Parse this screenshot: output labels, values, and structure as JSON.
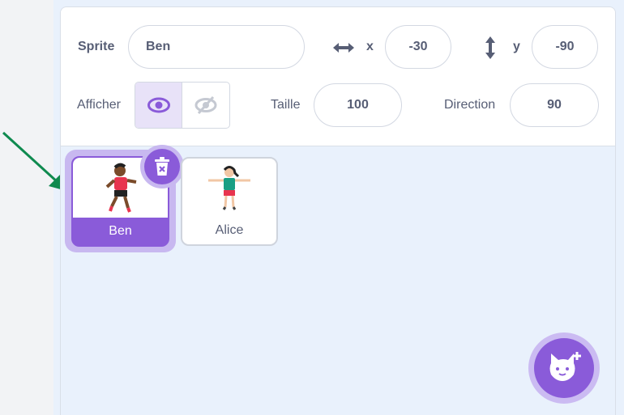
{
  "sprite_info": {
    "sprite_label": "Sprite",
    "sprite_name": "Ben",
    "x_label": "x",
    "x_value": "-30",
    "y_label": "y",
    "y_value": "-90",
    "show_label": "Afficher",
    "size_label": "Taille",
    "size_value": "100",
    "direction_label": "Direction",
    "direction_value": "90"
  },
  "sprites": [
    {
      "name": "Ben",
      "selected": true
    },
    {
      "name": "Alice",
      "selected": false
    }
  ],
  "colors": {
    "accent": "#8a5bd9",
    "pane_bg": "#e9f1fc",
    "arrow": "#0f8a4f"
  }
}
